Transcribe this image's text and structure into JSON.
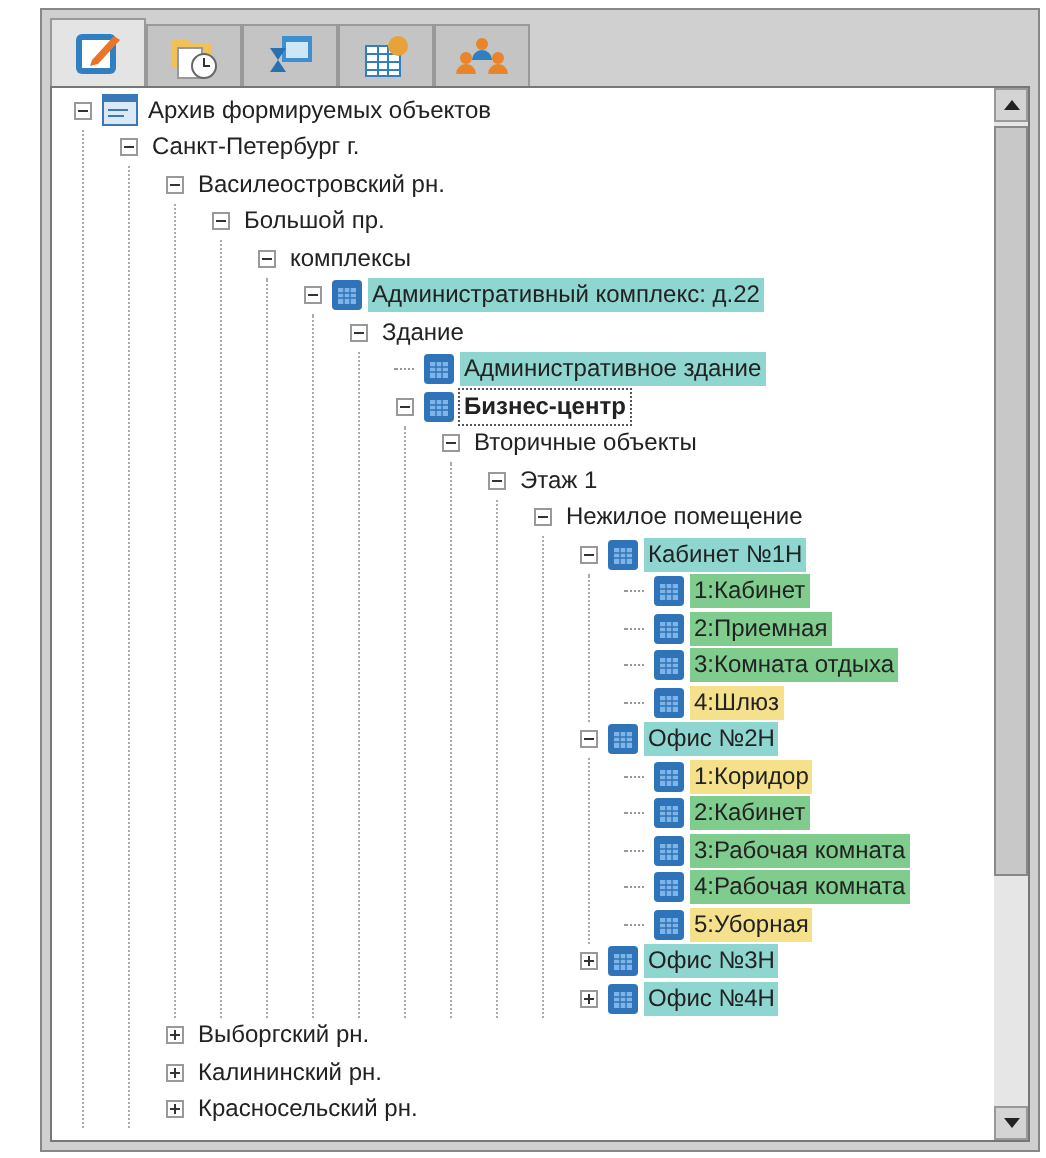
{
  "tabs": [
    {
      "selected": true
    },
    {
      "selected": false
    },
    {
      "selected": false
    },
    {
      "selected": false
    },
    {
      "selected": false
    }
  ],
  "tree": [
    {
      "label": "Архив формируемых объектов",
      "kind": "archive",
      "expanded": true,
      "selected": false,
      "children": [
        {
          "label": "Санкт-Петербург г.",
          "expanded": true,
          "selected": false,
          "children": [
            {
              "label": "Василеостровский рн.",
              "expanded": true,
              "selected": false,
              "children": [
                {
                  "label": "Большой пр.",
                  "expanded": true,
                  "selected": false,
                  "children": [
                    {
                      "label": "комплексы",
                      "expanded": true,
                      "selected": false,
                      "children": [
                        {
                          "label": "Административный комплекс: д.22",
                          "kind": "object",
                          "color": "#8fd5d0",
                          "expanded": true,
                          "selected": false,
                          "children": [
                            {
                              "label": "Здание",
                              "expanded": true,
                              "selected": false,
                              "children": [
                                {
                                  "label": "Административное здание",
                                  "kind": "object",
                                  "color": "#8fd5d0",
                                  "selected": false
                                },
                                {
                                  "label": "Бизнес-центр",
                                  "kind": "object",
                                  "expanded": true,
                                  "selected": true,
                                  "children": [
                                    {
                                      "label": "Вторичные объекты",
                                      "expanded": true,
                                      "selected": false,
                                      "children": [
                                        {
                                          "label": "Этаж 1",
                                          "expanded": true,
                                          "selected": false,
                                          "children": [
                                            {
                                              "label": "Нежилое помещение",
                                              "expanded": true,
                                              "selected": false,
                                              "children": [
                                                {
                                                  "label": "Кабинет №1Н",
                                                  "kind": "object",
                                                  "color": "#8fd5d0",
                                                  "expanded": true,
                                                  "selected": false,
                                                  "children": [
                                                    {
                                                      "label": "1:Кабинет",
                                                      "kind": "object",
                                                      "color": "#7fcc8e",
                                                      "selected": false
                                                    },
                                                    {
                                                      "label": "2:Приемная",
                                                      "kind": "object",
                                                      "color": "#7fcc8e",
                                                      "selected": false
                                                    },
                                                    {
                                                      "label": "3:Комната отдыха",
                                                      "kind": "object",
                                                      "color": "#7fcc8e",
                                                      "selected": false
                                                    },
                                                    {
                                                      "label": "4:Шлюз",
                                                      "kind": "object",
                                                      "color": "#f5e08c",
                                                      "selected": false
                                                    }
                                                  ]
                                                },
                                                {
                                                  "label": "Офис №2Н",
                                                  "kind": "object",
                                                  "color": "#8fd5d0",
                                                  "expanded": true,
                                                  "selected": false,
                                                  "children": [
                                                    {
                                                      "label": "1:Коридор",
                                                      "kind": "object",
                                                      "color": "#f5e08c",
                                                      "selected": false
                                                    },
                                                    {
                                                      "label": "2:Кабинет",
                                                      "kind": "object",
                                                      "color": "#7fcc8e",
                                                      "selected": false
                                                    },
                                                    {
                                                      "label": "3:Рабочая комната",
                                                      "kind": "object",
                                                      "color": "#7fcc8e",
                                                      "selected": false
                                                    },
                                                    {
                                                      "label": "4:Рабочая комната",
                                                      "kind": "object",
                                                      "color": "#7fcc8e",
                                                      "selected": false
                                                    },
                                                    {
                                                      "label": "5:Уборная",
                                                      "kind": "object",
                                                      "color": "#f5e08c",
                                                      "selected": false
                                                    }
                                                  ]
                                                },
                                                {
                                                  "label": "Офис №3Н",
                                                  "kind": "object",
                                                  "color": "#8fd5d0",
                                                  "expanded": false,
                                                  "selected": false
                                                },
                                                {
                                                  "label": "Офис №4Н",
                                                  "kind": "object",
                                                  "color": "#8fd5d0",
                                                  "expanded": false,
                                                  "selected": false
                                                }
                                              ]
                                            }
                                          ]
                                        }
                                      ]
                                    }
                                  ]
                                }
                              ]
                            }
                          ]
                        }
                      ]
                    }
                  ]
                }
              ]
            },
            {
              "label": "Выборгский рн.",
              "expanded": false,
              "selected": false
            },
            {
              "label": "Калининский рн.",
              "expanded": false,
              "selected": false
            },
            {
              "label": "Красносельский рн.",
              "expanded": false,
              "selected": false
            }
          ]
        }
      ]
    }
  ]
}
